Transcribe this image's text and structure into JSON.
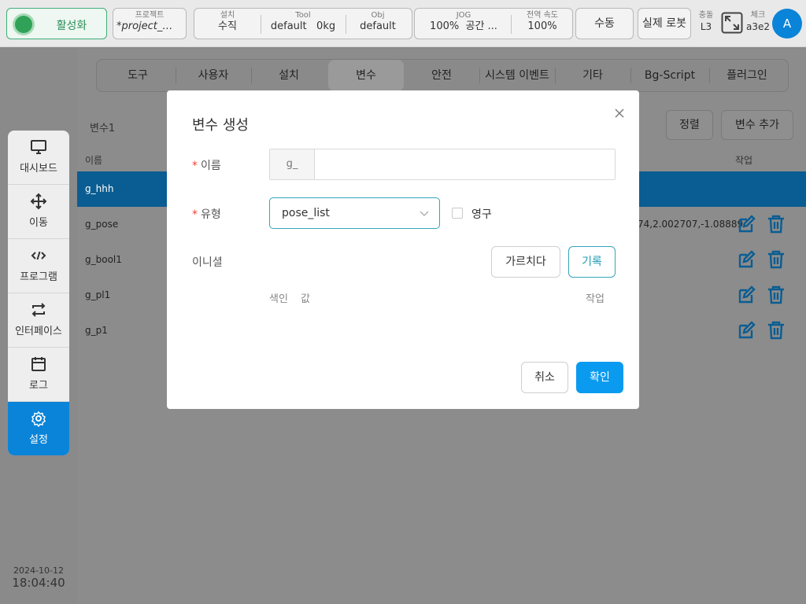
{
  "topbar": {
    "activate_label": "활성화",
    "project_label": "프로젝트",
    "project_value": "*project_mo...",
    "install_label": "설치",
    "install_value": "수직",
    "tool_label": "Tool",
    "tool_value": "default",
    "tool_weight": "0kg",
    "obj_label": "Obj",
    "obj_value": "default",
    "jog_label": "JOG",
    "jog_value": "100%",
    "jog_space": "공간 ...",
    "speed_label": "전역 속도",
    "speed_value": "100%",
    "manual_label": "수동",
    "realrobot_label": "실제 로봇",
    "collision_label": "충돌",
    "collision_value": "L3",
    "check_label": "체크",
    "check_value": "a3e2",
    "avatar_letter": "A"
  },
  "sidebar": {
    "items": [
      {
        "label": "대시보드",
        "icon": "monitor-icon"
      },
      {
        "label": "이동",
        "icon": "move-icon"
      },
      {
        "label": "프로그램",
        "icon": "code-icon"
      },
      {
        "label": "인터페이스",
        "icon": "swap-icon"
      },
      {
        "label": "로그",
        "icon": "calendar-icon"
      },
      {
        "label": "설정",
        "icon": "gear-icon"
      }
    ],
    "active": "설정",
    "date": "2024-10-12",
    "time": "18:04:40"
  },
  "tabs": [
    "도구",
    "사용자",
    "설치",
    "변수",
    "안전",
    "시스템 이벤트",
    "기타",
    "Bg-Script",
    "플러그인"
  ],
  "active_tab": "변수",
  "variables": {
    "heading": "변수1",
    "sort_label": "정렬",
    "add_label": "변수 추가",
    "col_name": "이름",
    "col_action": "작업",
    "rows": [
      {
        "name": "g_hhh",
        "value": ""
      },
      {
        "name": "g_pose",
        "value": "74,2.002707,-1.08889"
      },
      {
        "name": "g_bool1",
        "value": ""
      },
      {
        "name": "g_pl1",
        "value": ""
      },
      {
        "name": "g_p1",
        "value": ""
      }
    ]
  },
  "modal": {
    "title": "변수 생성",
    "name_label": "이름",
    "name_prefix": "g_",
    "name_value": "",
    "type_label": "유형",
    "type_value": "pose_list",
    "persistent_label": "영구",
    "initial_label": "이니셜",
    "teach_label": "가르치다",
    "record_label": "기록",
    "col_index": "색인",
    "col_value": "값",
    "col_action": "작업",
    "cancel_label": "취소",
    "confirm_label": "확인"
  },
  "colors": {
    "accent": "#0a84d8",
    "confirm": "#0a9bf0",
    "active_green": "#2fa257",
    "required": "#f04134",
    "select_border": "#36a5b8"
  }
}
